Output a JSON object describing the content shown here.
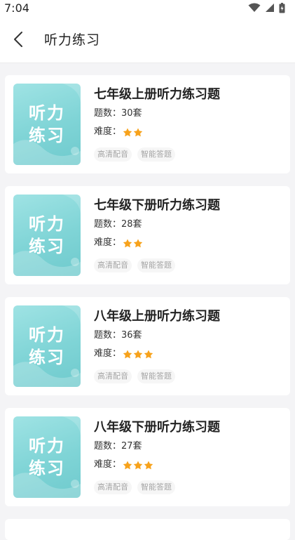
{
  "status_bar": {
    "time": "7:04"
  },
  "header": {
    "title": "听力练习"
  },
  "cover": {
    "line1": "听力",
    "line2": "练习"
  },
  "labels": {
    "count_prefix": "题数：",
    "difficulty_prefix": "难度："
  },
  "colors": {
    "star": "#f7a21b",
    "cover_teal": "#7fd4d6"
  },
  "items": [
    {
      "title": "七年级上册听力练习题",
      "count": "30套",
      "stars": 2,
      "tags": [
        "高清配音",
        "智能答题"
      ]
    },
    {
      "title": "七年级下册听力练习题",
      "count": "28套",
      "stars": 2,
      "tags": [
        "高清配音",
        "智能答题"
      ]
    },
    {
      "title": "八年级上册听力练习题",
      "count": "36套",
      "stars": 3,
      "tags": [
        "高清配音",
        "智能答题"
      ]
    },
    {
      "title": "八年级下册听力练习题",
      "count": "27套",
      "stars": 3,
      "tags": [
        "高清配音",
        "智能答题"
      ]
    }
  ]
}
